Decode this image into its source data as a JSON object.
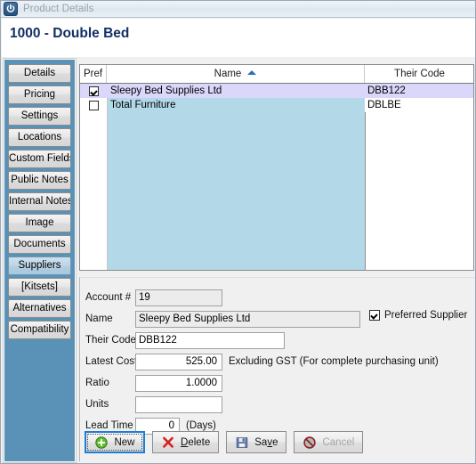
{
  "window": {
    "title": "Product Details",
    "icon": "power-icon",
    "product_heading": "1000 - Double Bed"
  },
  "sidebar": {
    "items": [
      {
        "label": "Details",
        "selected": false
      },
      {
        "label": "Pricing",
        "selected": false
      },
      {
        "label": "Settings",
        "selected": false
      },
      {
        "label": "Locations",
        "selected": false
      },
      {
        "label": "Custom Fields",
        "selected": false
      },
      {
        "label": "Public Notes",
        "selected": false
      },
      {
        "label": "Internal Notes",
        "selected": false
      },
      {
        "label": "Image",
        "selected": false
      },
      {
        "label": "Documents",
        "selected": false
      },
      {
        "label": "Suppliers",
        "selected": true
      },
      {
        "label": "[Kitsets]",
        "selected": false
      },
      {
        "label": "Alternatives",
        "selected": false
      },
      {
        "label": "Compatibility",
        "selected": false
      }
    ]
  },
  "grid": {
    "columns": [
      {
        "label": "Pref",
        "sorted": false
      },
      {
        "label": "Name",
        "sorted": true,
        "sort_direction": "asc",
        "sort_icon": "sort-ascending-icon"
      },
      {
        "label": "Their Code",
        "sorted": false
      }
    ],
    "rows": [
      {
        "pref": true,
        "name": "Sleepy Bed Supplies Ltd",
        "their_code": "DBB122",
        "selected": true
      },
      {
        "pref": false,
        "name": "Total Furniture",
        "their_code": "DBLBE",
        "selected": false
      }
    ],
    "selected_row_color": "#dad7fa",
    "column_fill_color": "#b3d8e8"
  },
  "form": {
    "account_label": "Account #",
    "account_value": "19",
    "name_label": "Name",
    "name_value": "Sleepy Bed Supplies Ltd",
    "preferred_label": "Preferred Supplier",
    "preferred_checked": true,
    "their_code_label": "Their Code",
    "their_code_value": "DBB122",
    "latest_cost_label": "Latest Cost",
    "latest_cost_value": "525.00",
    "latest_cost_hint": "Excluding GST (For complete purchasing unit)",
    "ratio_label": "Ratio",
    "ratio_value": "1.0000",
    "units_label": "Units",
    "units_value": "",
    "lead_time_label": "Lead Time",
    "lead_time_value": "0",
    "lead_time_hint": "(Days)"
  },
  "buttons": [
    {
      "label": "New",
      "accel_before": "New",
      "icon": "plus-circle-icon",
      "focused": true,
      "disabled": false
    },
    {
      "label": "Delete",
      "icon": "delete-x-icon",
      "accel_index": 1,
      "focused": false,
      "disabled": false
    },
    {
      "label": "Save",
      "icon": "save-floppy-icon",
      "accel_index": 2,
      "focused": false,
      "disabled": false
    },
    {
      "label": "Cancel",
      "icon": "cancel-prohibited-icon",
      "focused": false,
      "disabled": true
    }
  ],
  "colors": {
    "sidebar_blue": "#5a92b7",
    "heading_navy": "#122f63",
    "sort_arrow_blue": "#2f6fb5",
    "focus_blue": "#1d7fd4"
  }
}
